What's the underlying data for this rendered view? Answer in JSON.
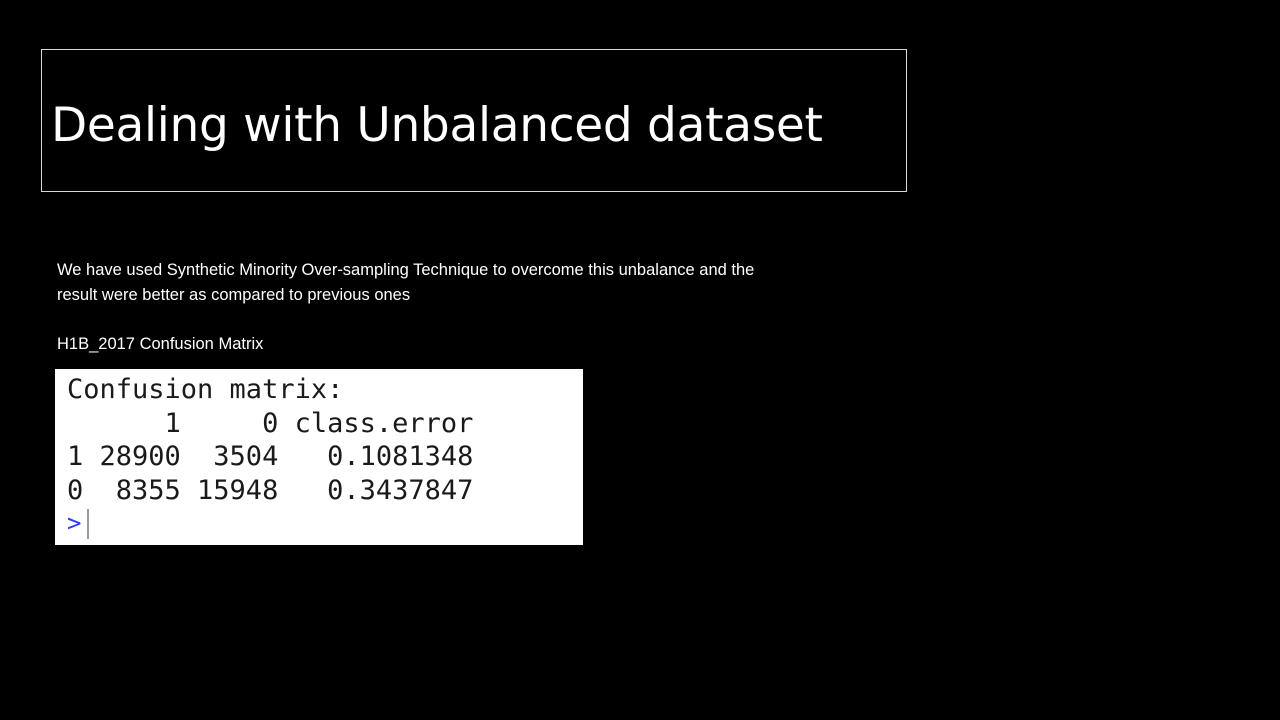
{
  "slide": {
    "title": "Dealing with Unbalanced dataset",
    "body_line_1": "We have used Synthetic Minority Over-sampling Technique to overcome this unbalance and the",
    "body_line_2": "result were better as compared to previous ones",
    "caption": "H1B_2017 Confusion Matrix"
  },
  "console": {
    "lines": [
      "Confusion matrix:",
      "      1     0 class.error",
      "1 28900  3504   0.1081348",
      "0  8355 15948   0.3437847"
    ],
    "prompt": ">",
    "colors": {
      "prompt": "#2a3cff",
      "text": "#1a1a1a",
      "background": "#ffffff"
    }
  }
}
